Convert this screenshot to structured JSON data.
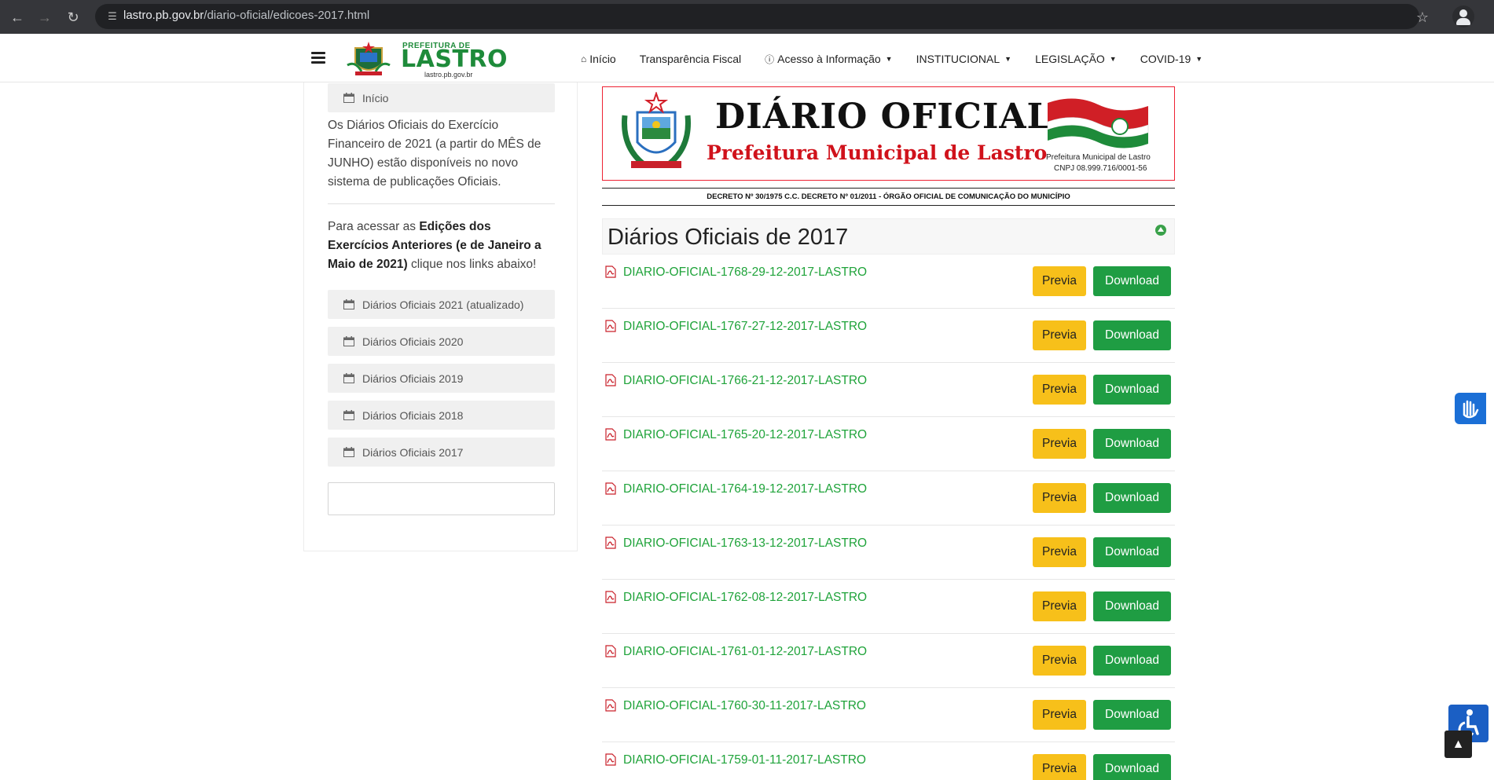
{
  "browser": {
    "url_host": "lastro.pb.gov.br",
    "url_path": "/diario-oficial/edicoes-2017.html"
  },
  "header": {
    "logo": {
      "prefeitura": "PREFEITURA DE",
      "name": "LASTRO",
      "site": "lastro.pb.gov.br"
    },
    "nav": [
      {
        "label": "Início",
        "icon": "home-icon"
      },
      {
        "label": "Transparência Fiscal"
      },
      {
        "label": "Acesso à Informação",
        "icon": "info-circle-icon",
        "dropdown": true
      },
      {
        "label": "INSTITUCIONAL",
        "dropdown": true
      },
      {
        "label": "LEGISLAÇÃO",
        "dropdown": true
      },
      {
        "label": "COVID-19",
        "dropdown": true
      }
    ]
  },
  "sidebar": {
    "home_label": "Início",
    "notice_text": "Os Diários Oficiais do Exercício Financeiro de 2021 (a partir do MÊS de JUNHO) estão disponíveis no novo sistema de publicações Oficiais.",
    "prev_prefix": "Para acessar as ",
    "prev_bold": "Edições dos Exercícios Anteriores (e de Janeiro a Maio de 2021)",
    "prev_suffix": " clique nos links abaixo!",
    "links": [
      "Diários Oficiais 2021 (atualizado)",
      "Diários Oficiais 2020",
      "Diários Oficiais 2019",
      "Diários Oficiais 2018",
      "Diários Oficiais 2017"
    ]
  },
  "banner": {
    "title": "DIÁRIO OFICIAL",
    "subtitle": "Prefeitura Municipal de Lastro",
    "org": "Prefeitura Municipal de Lastro",
    "cnpj": "CNPJ 08.999.716/0001-56",
    "decree": "DECRETO Nº 30/1975 C.C. DECRETO Nº 01/2011 - ÓRGÃO OFICIAL DE COMUNICAÇÃO DO MUNICÍPIO"
  },
  "main": {
    "heading": "Diários Oficiais de 2017",
    "previa_label": "Previa",
    "download_label": "Download",
    "documents": [
      "DIARIO-OFICIAL-1768-29-12-2017-LASTRO",
      "DIARIO-OFICIAL-1767-27-12-2017-LASTRO",
      "DIARIO-OFICIAL-1766-21-12-2017-LASTRO",
      "DIARIO-OFICIAL-1765-20-12-2017-LASTRO",
      "DIARIO-OFICIAL-1764-19-12-2017-LASTRO",
      "DIARIO-OFICIAL-1763-13-12-2017-LASTRO",
      "DIARIO-OFICIAL-1762-08-12-2017-LASTRO",
      "DIARIO-OFICIAL-1761-01-12-2017-LASTRO",
      "DIARIO-OFICIAL-1760-30-11-2017-LASTRO",
      "DIARIO-OFICIAL-1759-01-11-2017-LASTRO"
    ]
  },
  "colors": {
    "link_green": "#1fa33a",
    "previa_yellow": "#f7c01a",
    "download_green": "#1f9d43",
    "banner_red": "#d0121b"
  }
}
